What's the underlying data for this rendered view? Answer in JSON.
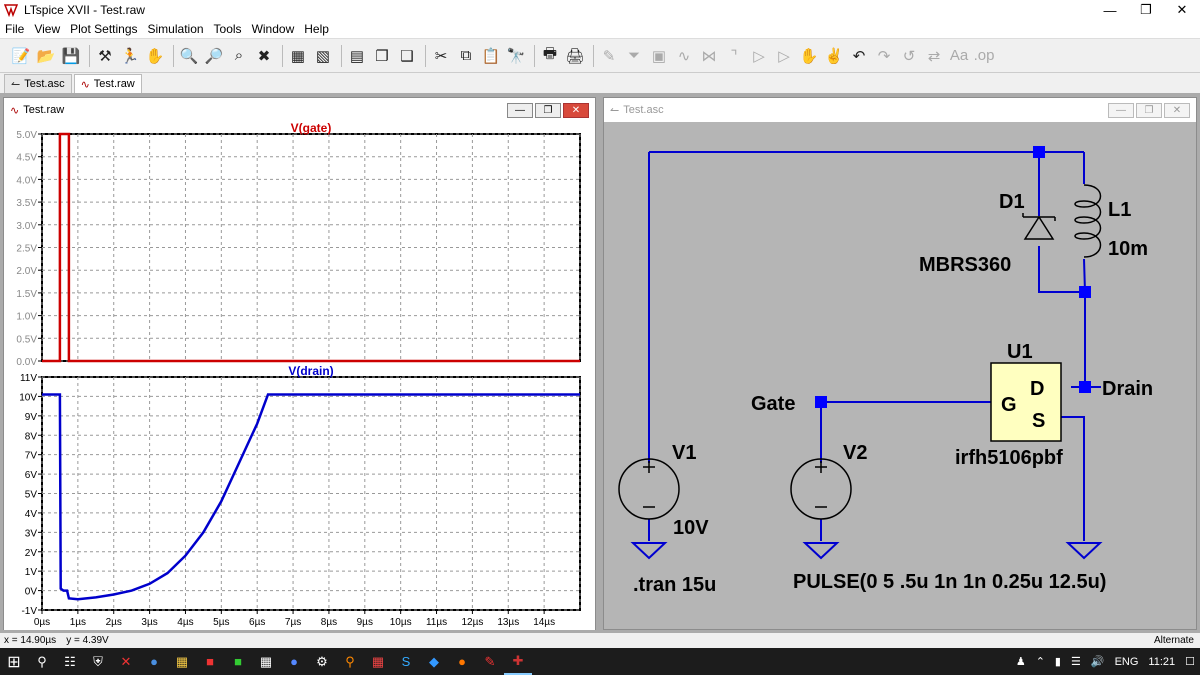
{
  "window": {
    "title": "LTspice XVII - Test.raw"
  },
  "menu": [
    "File",
    "View",
    "Plot Settings",
    "Simulation",
    "Tools",
    "Window",
    "Help"
  ],
  "doc_tabs": [
    {
      "label": "Test.asc",
      "active": false
    },
    {
      "label": "Test.raw",
      "active": true
    }
  ],
  "plot_window": {
    "title": "Test.raw",
    "pane1": {
      "trace_label": "V(gate)",
      "trace_color": "#cc0000",
      "y_ticks": [
        "5.0V",
        "4.5V",
        "4.0V",
        "3.5V",
        "3.0V",
        "2.5V",
        "2.0V",
        "1.5V",
        "1.0V",
        "0.5V",
        "0.0V"
      ]
    },
    "pane2": {
      "trace_label": "V(drain)",
      "trace_color": "#0000cc",
      "y_ticks": [
        "11V",
        "10V",
        "9V",
        "8V",
        "7V",
        "6V",
        "5V",
        "4V",
        "3V",
        "2V",
        "1V",
        "0V",
        "-1V"
      ]
    },
    "x_ticks": [
      "0µs",
      "1µs",
      "2µs",
      "3µs",
      "4µs",
      "5µs",
      "6µs",
      "7µs",
      "8µs",
      "9µs",
      "10µs",
      "11µs",
      "12µs",
      "13µs",
      "14µs"
    ]
  },
  "chart_data": [
    {
      "type": "line",
      "title": "V(gate)",
      "xlabel": "",
      "ylabel": "",
      "xlim": [
        0,
        15
      ],
      "ylim": [
        0,
        5
      ],
      "x_unit": "µs",
      "y_unit": "V",
      "series": [
        {
          "name": "V(gate)",
          "color": "#cc0000",
          "x": [
            0,
            0.5,
            0.5,
            0.75,
            0.75,
            15
          ],
          "y": [
            0,
            0,
            5,
            5,
            0,
            0
          ]
        }
      ]
    },
    {
      "type": "line",
      "title": "V(drain)",
      "xlabel": "",
      "ylabel": "",
      "xlim": [
        0,
        15
      ],
      "ylim": [
        -1,
        11
      ],
      "x_unit": "µs",
      "y_unit": "V",
      "series": [
        {
          "name": "V(drain)",
          "color": "#0000cc",
          "x": [
            0,
            0.5,
            0.52,
            0.6,
            0.7,
            0.75,
            1,
            1.5,
            2,
            2.5,
            3,
            3.5,
            4,
            4.5,
            5,
            5.5,
            5.8,
            6,
            6.3,
            7,
            8,
            10,
            12,
            15
          ],
          "y": [
            10.1,
            10.1,
            0.1,
            0,
            0,
            -0.4,
            -0.45,
            -0.35,
            -0.2,
            0,
            0.35,
            0.9,
            1.8,
            3.0,
            4.6,
            6.6,
            7.8,
            8.6,
            10.1,
            10.1,
            10.1,
            10.1,
            10.1,
            10.1
          ]
        }
      ]
    }
  ],
  "schematic_window": {
    "title": "Test.asc",
    "labels": {
      "d1": "D1",
      "d1_model": "MBRS360",
      "l1": "L1",
      "l1_value": "10m",
      "u1": "U1",
      "u1_model": "irfh5106pbf",
      "pin_g": "G",
      "pin_d": "D",
      "pin_s": "S",
      "drain_net": "Drain",
      "gate_net": "Gate",
      "v1": "V1",
      "v1_value": "10V",
      "v2": "V2",
      "v2_value": "PULSE(0 5 .5u 1n 1n 0.25u 12.5u)",
      "directive": ".tran 15u"
    }
  },
  "status": {
    "cursor_x": "x = 14.90µs",
    "cursor_y": "y = 4.39V",
    "mode": "Alternate"
  },
  "taskbar": {
    "language": "ENG",
    "time": "11:21"
  }
}
